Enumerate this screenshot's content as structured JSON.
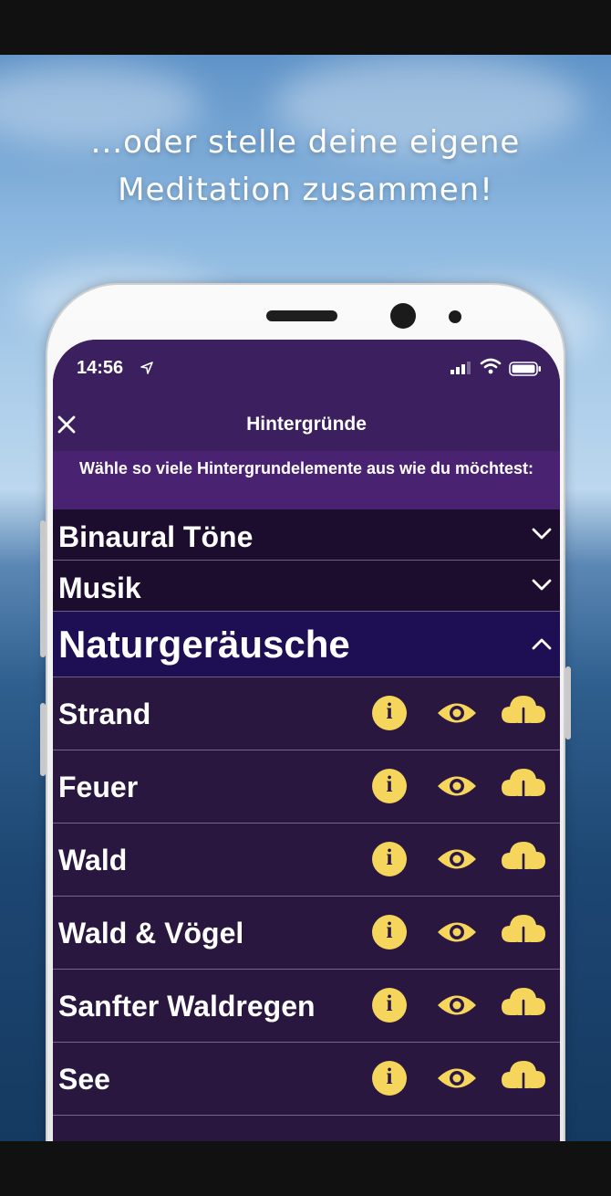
{
  "headline": {
    "line1": "...oder stelle deine eigene",
    "line2": "Meditation zusammen!"
  },
  "status_bar": {
    "time": "14:56"
  },
  "nav": {
    "title": "Hintergründe"
  },
  "subheader": {
    "text": "Wähle so viele Hintergrundelemente aus wie du möchtest:"
  },
  "sections": [
    {
      "label": "Binaural Töne",
      "expanded": false
    },
    {
      "label": "Musik",
      "expanded": false
    },
    {
      "label": "Naturgeräusche",
      "expanded": true
    }
  ],
  "nature_items": [
    {
      "label": "Strand"
    },
    {
      "label": "Feuer"
    },
    {
      "label": "Wald"
    },
    {
      "label": "Wald & Vögel"
    },
    {
      "label": "Sanfter Waldregen"
    },
    {
      "label": "See"
    }
  ],
  "icons": {
    "info_glyph": "i"
  },
  "colors": {
    "accent_yellow": "#f6d55c",
    "screen_purple": "#2a1749",
    "header_purple": "#3b1f5e"
  }
}
